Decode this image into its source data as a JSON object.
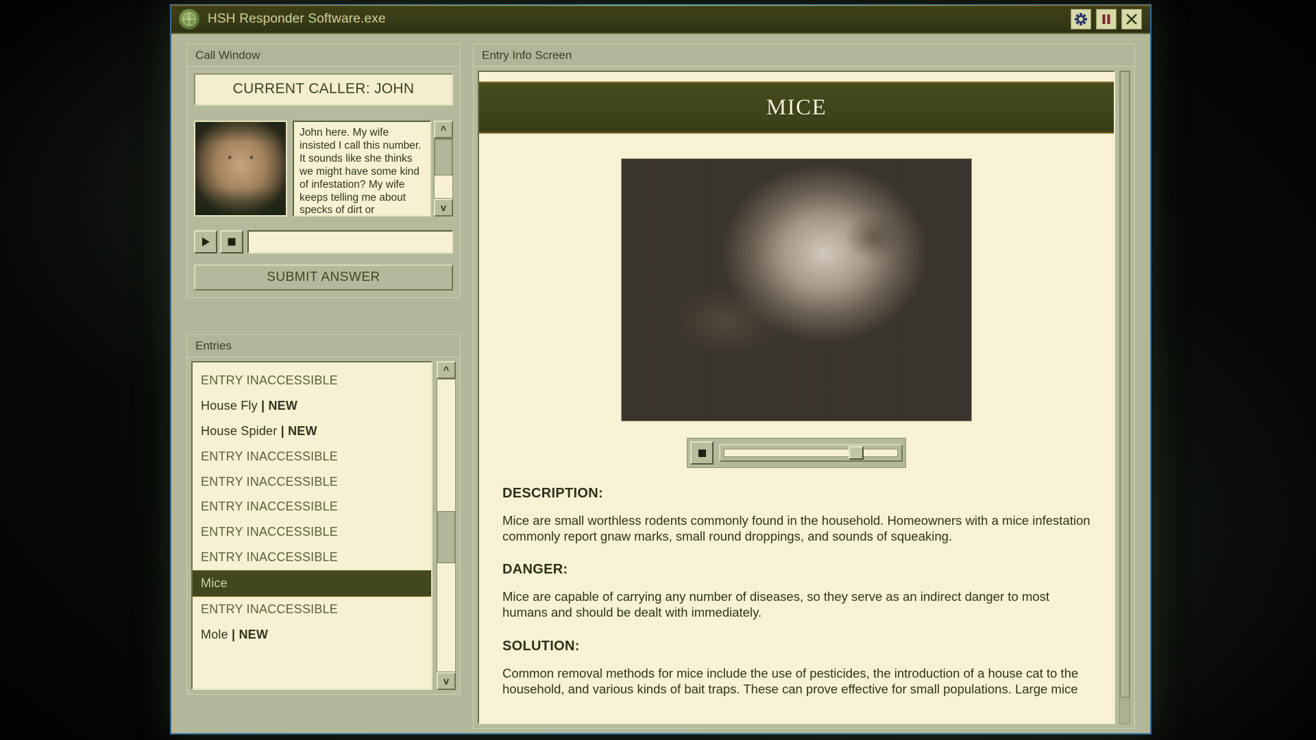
{
  "window": {
    "title": "HSH Responder Software.exe",
    "logo_icon": "hsh-emblem-icon",
    "buttons": [
      {
        "name": "settings-button",
        "icon": "gear-icon"
      },
      {
        "name": "pause-button",
        "icon": "pause-icon"
      },
      {
        "name": "close-button",
        "icon": "close-x-icon"
      }
    ]
  },
  "call_window": {
    "panel_label": "Call Window",
    "caller_banner": "CURRENT CALLER: JOHN",
    "portrait_alt": "caller-portrait-john",
    "dialogue": "John here. My wife insisted I call this number. It sounds like she thinks we might have some kind of infestation? My wife keeps telling me about specks of dirt or",
    "play_icon": "play-icon",
    "stop_icon": "stop-icon",
    "answer_value": "",
    "answer_placeholder": "",
    "submit_label": "SUBMIT ANSWER",
    "scroll_up": "^",
    "scroll_down": "v"
  },
  "entries": {
    "panel_label": "Entries",
    "scroll_up": "^",
    "scroll_down": "v",
    "scroll_thumb_pct": 45,
    "items": [
      {
        "label": "ENTRY INACCESSIBLE",
        "state": "locked",
        "badge": ""
      },
      {
        "label": "House Fly",
        "state": "unlocked",
        "badge": "NEW"
      },
      {
        "label": "House Spider",
        "state": "unlocked",
        "badge": "NEW"
      },
      {
        "label": "ENTRY INACCESSIBLE",
        "state": "locked",
        "badge": ""
      },
      {
        "label": "ENTRY INACCESSIBLE",
        "state": "locked",
        "badge": ""
      },
      {
        "label": "ENTRY INACCESSIBLE",
        "state": "locked",
        "badge": ""
      },
      {
        "label": "ENTRY INACCESSIBLE",
        "state": "locked",
        "badge": ""
      },
      {
        "label": "ENTRY INACCESSIBLE",
        "state": "locked",
        "badge": ""
      },
      {
        "label": "Mice",
        "state": "selected",
        "badge": ""
      },
      {
        "label": "ENTRY INACCESSIBLE",
        "state": "locked",
        "badge": ""
      },
      {
        "label": "Mole",
        "state": "unlocked",
        "badge": "NEW"
      }
    ]
  },
  "entry_info": {
    "panel_label": "Entry Info Screen",
    "title": "MICE",
    "photo_alt": "mouse-photograph",
    "slider": {
      "stop_icon": "stop-icon",
      "thumb_pct": 75
    },
    "sections": [
      {
        "heading": "DESCRIPTION:",
        "body": "Mice are small worthless rodents commonly found in the household. Homeowners with a mice infestation commonly report gnaw marks, small round droppings, and sounds of squeaking."
      },
      {
        "heading": "DANGER:",
        "body": "Mice are capable of carrying any number of diseases, so they serve as an indirect danger to most humans and should be dealt with immediately."
      },
      {
        "heading": "SOLUTION:",
        "body": "Common removal methods for mice include the use of pesticides, the introduction of a house cat to the household, and various kinds of bait traps. These can prove effective for small populations. Large mice"
      }
    ]
  },
  "colors": {
    "window_border": "#2f6f9e",
    "titlebar": "#383b16",
    "title_text": "#c9cf8a",
    "panel_bg": "#b6ba9c",
    "page_bg": "#f7f2d4",
    "banner_olive": "#42471c",
    "accent_gold": "#8a6a22",
    "text_dark": "#2f341c",
    "text_muted": "#5a5f3c"
  }
}
